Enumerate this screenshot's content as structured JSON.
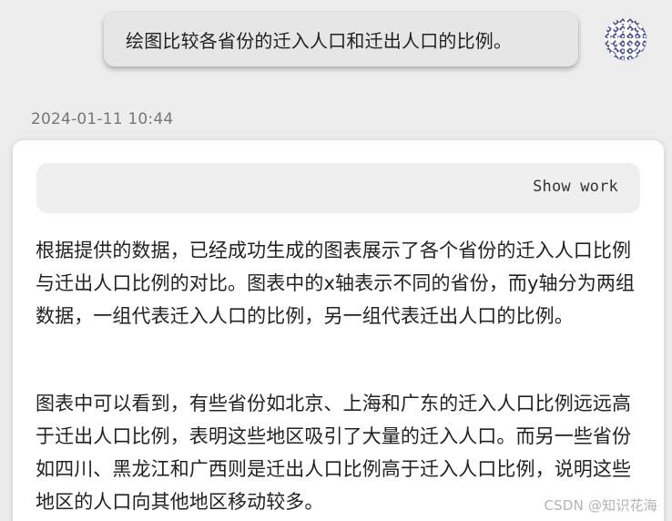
{
  "conversation": {
    "user_message": "绘图比较各省份的迁入人口和迁出人口的比例。",
    "timestamp": "2024-01-11 10:44",
    "assistant": {
      "show_work_label": "Show work",
      "paragraphs": [
        "根据提供的数据，已经成功生成的图表展示了各个省份的迁入人口比例与迁出人口比例的对比。图表中的x轴表示不同的省份，而y轴分为两组数据，一组代表迁入人口的比例，另一组代表迁出人口的比例。",
        "图表中可以看到，有些省份如北京、上海和广东的迁入人口比例远远高于迁出人口比例，表明这些地区吸引了大量的迁入人口。而另一些省份如四川、黑龙江和广西则是迁出人口比例高于迁入人口比例，说明这些地区的人口向其他地区移动较多。"
      ]
    }
  },
  "watermark": "CSDN @知识花海",
  "icons": {
    "user_avatar": "user-avatar-icon"
  },
  "colors": {
    "page_background": "#ededed",
    "user_bubble": "#e6e6e6",
    "assistant_card": "#ffffff",
    "show_work_bar": "#efefef",
    "avatar_pattern": "#3f4d8f",
    "watermark": "#b3b3b3"
  }
}
